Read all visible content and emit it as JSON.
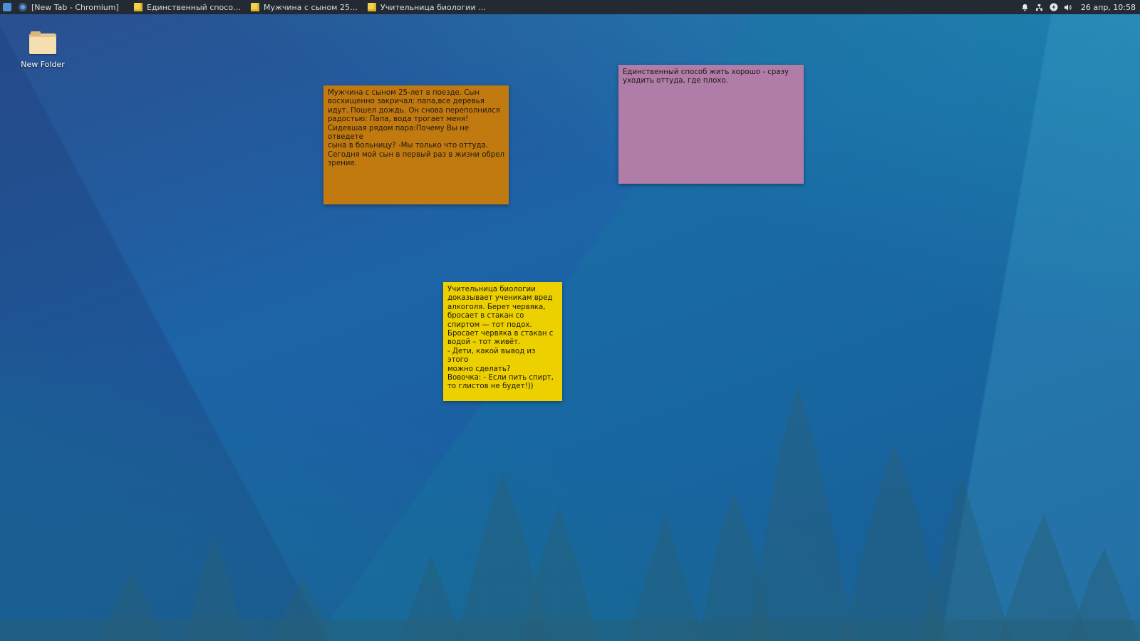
{
  "taskbar": {
    "tasks": [
      {
        "title": "[New Tab - Chromium]"
      },
      {
        "title": "Единственный способ жит..."
      },
      {
        "title": "Мужчина с сыном 25-лет в..."
      },
      {
        "title": "Учительница биологии до..."
      }
    ],
    "tray_icons": [
      "bell-icon",
      "network-icon",
      "power-icon",
      "volume-icon"
    ],
    "clock": "26 апр, 10:58"
  },
  "desktop": {
    "items": [
      {
        "label": "New Folder",
        "icon": "folder-icon"
      }
    ]
  },
  "notes": [
    {
      "color": "#c17a10",
      "text": "Мужчина с сыном 25-лет в поезде. Сын\nвосхищенно закричал: папа,все деревья\nидут. Пошел дождь. Он снова переполнился\nрадостью: Папа, вода трогает меня!\nСидевшая рядом пара:Почему Вы не отведете\nсына в больницу? -Мы только что оттуда.\nСегодня мой сын в первый раз в жизни обрел\nзрение."
    },
    {
      "color": "#b07ca8",
      "text": "Единственный способ жить хорошо - сразу\nуходить оттуда, где плохо."
    },
    {
      "color": "#ecd000",
      "text": "Учительница биологии\nдоказывает ученикам вред\nалкоголя. Берет червяка,\nбросает в стакан со\nспиртом — тот подох.\nБросает червяка в стакан с\nводой – тот живёт.\n- Дети, какой вывод из этого\nможно сделать?\nВовочка: - Если пить спирт,\nто глистов не будет!))"
    }
  ]
}
